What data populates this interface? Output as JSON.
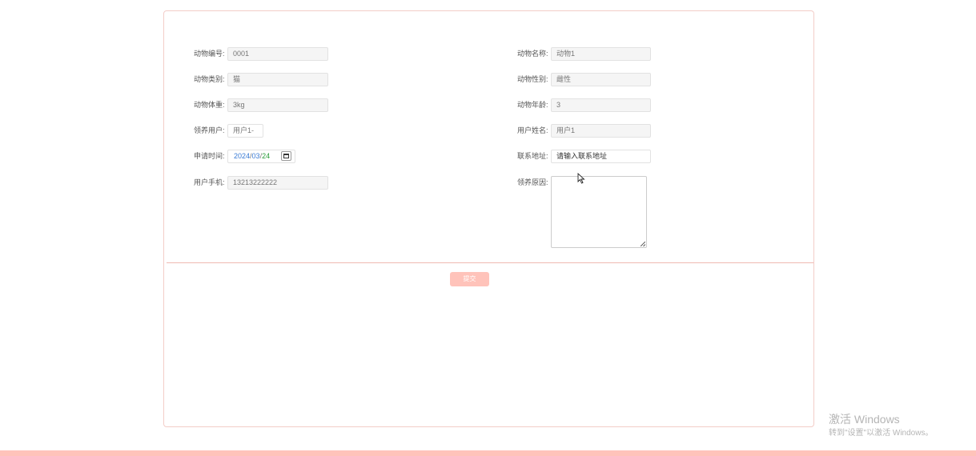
{
  "form": {
    "animal_id": {
      "label": "动物编号:",
      "value": "0001"
    },
    "animal_name": {
      "label": "动物名称:",
      "value": "动物1"
    },
    "animal_category": {
      "label": "动物类别:",
      "value": "猫"
    },
    "animal_gender": {
      "label": "动物性别:",
      "value": "雌性"
    },
    "animal_weight": {
      "label": "动物体重:",
      "value": "3kg"
    },
    "animal_age": {
      "label": "动物年龄:",
      "value": "3"
    },
    "adopt_user": {
      "label": "领养用户:",
      "value": "用户1-"
    },
    "user_name": {
      "label": "用户姓名:",
      "value": "用户1"
    },
    "apply_time": {
      "label": "申请时间:",
      "year": "2024",
      "month": "03",
      "day": "24",
      "sep": "/"
    },
    "address": {
      "label": "联系地址:",
      "placeholder": "请输入联系地址"
    },
    "user_phone": {
      "label": "用户手机:",
      "value": "13213222222"
    },
    "adopt_reason": {
      "label": "领养原因:",
      "value": ""
    }
  },
  "submit_label": "提交",
  "watermark": {
    "title": "激活 Windows",
    "subtitle": "转到\"设置\"以激活 Windows。"
  },
  "colors": {
    "accent": "#ffc3ba",
    "panel_border": "#f3cdc8"
  },
  "icons": {
    "calendar": "calendar-icon",
    "cursor": "mouse-pointer-icon"
  }
}
